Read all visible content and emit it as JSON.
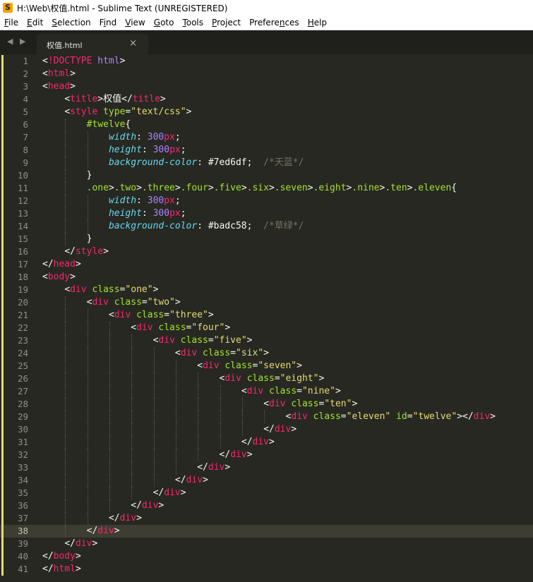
{
  "window": {
    "title": "H:\\Web\\权值.html - Sublime Text (UNREGISTERED)"
  },
  "menu": [
    {
      "label": "File",
      "key": "F"
    },
    {
      "label": "Edit",
      "key": "E"
    },
    {
      "label": "Selection",
      "key": "S"
    },
    {
      "label": "Find",
      "key": "i"
    },
    {
      "label": "View",
      "key": "V"
    },
    {
      "label": "Goto",
      "key": "G"
    },
    {
      "label": "Tools",
      "key": "T"
    },
    {
      "label": "Project",
      "key": "P"
    },
    {
      "label": "Preferences",
      "key": "n"
    },
    {
      "label": "Help",
      "key": "H"
    }
  ],
  "tabs": {
    "arrows": "◀ ▶",
    "active_label": "权值.html",
    "close_glyph": "×"
  },
  "editor": {
    "current_line": 38,
    "marker_color": "#e6db74",
    "lines": [
      {
        "n": "1",
        "i": 0,
        "t": [
          [
            "t-punct",
            "<"
          ],
          [
            "t-tag",
            "!DOCTYPE"
          ],
          [
            "t-text",
            " "
          ],
          [
            "t-num",
            "html"
          ],
          [
            "t-punct",
            ">"
          ]
        ]
      },
      {
        "n": "2",
        "i": 0,
        "t": [
          [
            "t-punct",
            "<"
          ],
          [
            "t-tag",
            "html"
          ],
          [
            "t-punct",
            ">"
          ]
        ]
      },
      {
        "n": "3",
        "i": 0,
        "t": [
          [
            "t-punct",
            "<"
          ],
          [
            "t-tag",
            "head"
          ],
          [
            "t-punct",
            ">"
          ]
        ]
      },
      {
        "n": "4",
        "i": 1,
        "t": [
          [
            "t-punct",
            "<"
          ],
          [
            "t-tag",
            "title"
          ],
          [
            "t-punct",
            ">"
          ],
          [
            "t-text",
            "权值"
          ],
          [
            "t-punct",
            "</"
          ],
          [
            "t-tag",
            "title"
          ],
          [
            "t-punct",
            ">"
          ]
        ]
      },
      {
        "n": "5",
        "i": 1,
        "t": [
          [
            "t-punct",
            "<"
          ],
          [
            "t-tag",
            "style"
          ],
          [
            "t-text",
            " "
          ],
          [
            "t-attr",
            "type"
          ],
          [
            "t-punct",
            "="
          ],
          [
            "t-str",
            "\"text/css\""
          ],
          [
            "t-punct",
            ">"
          ]
        ]
      },
      {
        "n": "6",
        "i": 2,
        "t": [
          [
            "t-sel",
            "#twelve"
          ],
          [
            "t-punct",
            "{"
          ]
        ]
      },
      {
        "n": "7",
        "i": 3,
        "t": [
          [
            "t-prop",
            "width"
          ],
          [
            "t-punct",
            ": "
          ],
          [
            "t-num",
            "300"
          ],
          [
            "t-tag",
            "px"
          ],
          [
            "t-punct",
            ";"
          ]
        ]
      },
      {
        "n": "8",
        "i": 3,
        "t": [
          [
            "t-prop",
            "height"
          ],
          [
            "t-punct",
            ": "
          ],
          [
            "t-num",
            "300"
          ],
          [
            "t-tag",
            "px"
          ],
          [
            "t-punct",
            ";"
          ]
        ]
      },
      {
        "n": "9",
        "i": 3,
        "t": [
          [
            "t-prop",
            "background-color"
          ],
          [
            "t-punct",
            ": "
          ],
          [
            "t-text",
            "#7ed6df"
          ],
          [
            "t-punct",
            ";  "
          ],
          [
            "t-com",
            "/*天蓝*/"
          ]
        ]
      },
      {
        "n": "10",
        "i": 2,
        "t": [
          [
            "t-punct",
            "}"
          ]
        ]
      },
      {
        "n": "11",
        "i": 2,
        "t": [
          [
            "t-sel",
            ".one"
          ],
          [
            "t-punct",
            ">"
          ],
          [
            "t-sel",
            ".two"
          ],
          [
            "t-punct",
            ">"
          ],
          [
            "t-sel",
            ".three"
          ],
          [
            "t-punct",
            ">"
          ],
          [
            "t-sel",
            ".four"
          ],
          [
            "t-punct",
            ">"
          ],
          [
            "t-sel",
            ".five"
          ],
          [
            "t-punct",
            ">"
          ],
          [
            "t-sel",
            ".six"
          ],
          [
            "t-punct",
            ">"
          ],
          [
            "t-sel",
            ".seven"
          ],
          [
            "t-punct",
            ">"
          ],
          [
            "t-sel",
            ".eight"
          ],
          [
            "t-punct",
            ">"
          ],
          [
            "t-sel",
            ".nine"
          ],
          [
            "t-punct",
            ">"
          ],
          [
            "t-sel",
            ".ten"
          ],
          [
            "t-punct",
            ">"
          ],
          [
            "t-sel",
            ".eleven"
          ],
          [
            "t-punct",
            "{"
          ]
        ]
      },
      {
        "n": "12",
        "i": 3,
        "t": [
          [
            "t-prop",
            "width"
          ],
          [
            "t-punct",
            ": "
          ],
          [
            "t-num",
            "300"
          ],
          [
            "t-tag",
            "px"
          ],
          [
            "t-punct",
            ";"
          ]
        ]
      },
      {
        "n": "13",
        "i": 3,
        "t": [
          [
            "t-prop",
            "height"
          ],
          [
            "t-punct",
            ": "
          ],
          [
            "t-num",
            "300"
          ],
          [
            "t-tag",
            "px"
          ],
          [
            "t-punct",
            ";"
          ]
        ]
      },
      {
        "n": "14",
        "i": 3,
        "t": [
          [
            "t-prop",
            "background-color"
          ],
          [
            "t-punct",
            ": "
          ],
          [
            "t-text",
            "#badc58"
          ],
          [
            "t-punct",
            ";  "
          ],
          [
            "t-com",
            "/*草绿*/"
          ]
        ]
      },
      {
        "n": "15",
        "i": 2,
        "t": [
          [
            "t-punct",
            "}"
          ]
        ]
      },
      {
        "n": "16",
        "i": 1,
        "t": [
          [
            "t-punct",
            "</"
          ],
          [
            "t-tag",
            "style"
          ],
          [
            "t-punct",
            ">"
          ]
        ]
      },
      {
        "n": "17",
        "i": 0,
        "t": [
          [
            "t-punct",
            "</"
          ],
          [
            "t-tag",
            "head"
          ],
          [
            "t-punct",
            ">"
          ]
        ]
      },
      {
        "n": "18",
        "i": 0,
        "t": [
          [
            "t-punct",
            "<"
          ],
          [
            "t-tag",
            "body"
          ],
          [
            "t-punct",
            ">"
          ]
        ]
      },
      {
        "n": "19",
        "i": 1,
        "t": [
          [
            "t-punct",
            "<"
          ],
          [
            "t-tag",
            "div"
          ],
          [
            "t-text",
            " "
          ],
          [
            "t-attr",
            "class"
          ],
          [
            "t-punct",
            "="
          ],
          [
            "t-str",
            "\"one\""
          ],
          [
            "t-punct",
            ">"
          ]
        ]
      },
      {
        "n": "20",
        "i": 2,
        "t": [
          [
            "t-punct",
            "<"
          ],
          [
            "t-tag",
            "div"
          ],
          [
            "t-text",
            " "
          ],
          [
            "t-attr",
            "class"
          ],
          [
            "t-punct",
            "="
          ],
          [
            "t-str",
            "\"two\""
          ],
          [
            "t-punct",
            ">"
          ]
        ]
      },
      {
        "n": "21",
        "i": 3,
        "t": [
          [
            "t-punct",
            "<"
          ],
          [
            "t-tag",
            "div"
          ],
          [
            "t-text",
            " "
          ],
          [
            "t-attr",
            "class"
          ],
          [
            "t-punct",
            "="
          ],
          [
            "t-str",
            "\"three\""
          ],
          [
            "t-punct",
            ">"
          ]
        ]
      },
      {
        "n": "22",
        "i": 4,
        "t": [
          [
            "t-punct",
            "<"
          ],
          [
            "t-tag",
            "div"
          ],
          [
            "t-text",
            " "
          ],
          [
            "t-attr",
            "class"
          ],
          [
            "t-punct",
            "="
          ],
          [
            "t-str",
            "\"four\""
          ],
          [
            "t-punct",
            ">"
          ]
        ]
      },
      {
        "n": "23",
        "i": 5,
        "t": [
          [
            "t-punct",
            "<"
          ],
          [
            "t-tag",
            "div"
          ],
          [
            "t-text",
            " "
          ],
          [
            "t-attr",
            "class"
          ],
          [
            "t-punct",
            "="
          ],
          [
            "t-str",
            "\"five\""
          ],
          [
            "t-punct",
            ">"
          ]
        ]
      },
      {
        "n": "24",
        "i": 6,
        "t": [
          [
            "t-punct",
            "<"
          ],
          [
            "t-tag",
            "div"
          ],
          [
            "t-text",
            " "
          ],
          [
            "t-attr",
            "class"
          ],
          [
            "t-punct",
            "="
          ],
          [
            "t-str",
            "\"six\""
          ],
          [
            "t-punct",
            ">"
          ]
        ]
      },
      {
        "n": "25",
        "i": 7,
        "t": [
          [
            "t-punct",
            "<"
          ],
          [
            "t-tag",
            "div"
          ],
          [
            "t-text",
            " "
          ],
          [
            "t-attr",
            "class"
          ],
          [
            "t-punct",
            "="
          ],
          [
            "t-str",
            "\"seven\""
          ],
          [
            "t-punct",
            ">"
          ]
        ]
      },
      {
        "n": "26",
        "i": 8,
        "t": [
          [
            "t-punct",
            "<"
          ],
          [
            "t-tag",
            "div"
          ],
          [
            "t-text",
            " "
          ],
          [
            "t-attr",
            "class"
          ],
          [
            "t-punct",
            "="
          ],
          [
            "t-str",
            "\"eight\""
          ],
          [
            "t-punct",
            ">"
          ]
        ]
      },
      {
        "n": "27",
        "i": 9,
        "t": [
          [
            "t-punct",
            "<"
          ],
          [
            "t-tag",
            "div"
          ],
          [
            "t-text",
            " "
          ],
          [
            "t-attr",
            "class"
          ],
          [
            "t-punct",
            "="
          ],
          [
            "t-str",
            "\"nine\""
          ],
          [
            "t-punct",
            ">"
          ]
        ]
      },
      {
        "n": "28",
        "i": 10,
        "t": [
          [
            "t-punct",
            "<"
          ],
          [
            "t-tag",
            "div"
          ],
          [
            "t-text",
            " "
          ],
          [
            "t-attr",
            "class"
          ],
          [
            "t-punct",
            "="
          ],
          [
            "t-str",
            "\"ten\""
          ],
          [
            "t-punct",
            ">"
          ]
        ]
      },
      {
        "n": "29",
        "i": 11,
        "t": [
          [
            "t-punct",
            "<"
          ],
          [
            "t-tag",
            "div"
          ],
          [
            "t-text",
            " "
          ],
          [
            "t-attr",
            "class"
          ],
          [
            "t-punct",
            "="
          ],
          [
            "t-str",
            "\"eleven\""
          ],
          [
            "t-text",
            " "
          ],
          [
            "t-attr",
            "id"
          ],
          [
            "t-punct",
            "="
          ],
          [
            "t-str",
            "\"twelve\""
          ],
          [
            "t-punct",
            "></"
          ],
          [
            "t-tag",
            "div"
          ],
          [
            "t-punct",
            ">"
          ]
        ]
      },
      {
        "n": "30",
        "i": 10,
        "t": [
          [
            "t-punct",
            "</"
          ],
          [
            "t-tag",
            "div"
          ],
          [
            "t-punct",
            ">"
          ]
        ]
      },
      {
        "n": "31",
        "i": 9,
        "t": [
          [
            "t-punct",
            "</"
          ],
          [
            "t-tag",
            "div"
          ],
          [
            "t-punct",
            ">"
          ]
        ]
      },
      {
        "n": "32",
        "i": 8,
        "t": [
          [
            "t-punct",
            "</"
          ],
          [
            "t-tag",
            "div"
          ],
          [
            "t-punct",
            ">"
          ]
        ]
      },
      {
        "n": "33",
        "i": 7,
        "t": [
          [
            "t-punct",
            "</"
          ],
          [
            "t-tag",
            "div"
          ],
          [
            "t-punct",
            ">"
          ]
        ]
      },
      {
        "n": "34",
        "i": 6,
        "t": [
          [
            "t-punct",
            "</"
          ],
          [
            "t-tag",
            "div"
          ],
          [
            "t-punct",
            ">"
          ]
        ]
      },
      {
        "n": "35",
        "i": 5,
        "t": [
          [
            "t-punct",
            "</"
          ],
          [
            "t-tag",
            "div"
          ],
          [
            "t-punct",
            ">"
          ]
        ]
      },
      {
        "n": "36",
        "i": 4,
        "t": [
          [
            "t-punct",
            "</"
          ],
          [
            "t-tag",
            "div"
          ],
          [
            "t-punct",
            ">"
          ]
        ]
      },
      {
        "n": "37",
        "i": 3,
        "t": [
          [
            "t-punct",
            "</"
          ],
          [
            "t-tag",
            "div"
          ],
          [
            "t-punct",
            ">"
          ]
        ]
      },
      {
        "n": "38",
        "i": 2,
        "t": [
          [
            "t-punct",
            "</"
          ],
          [
            "t-tag",
            "div"
          ],
          [
            "t-punct",
            ">"
          ]
        ]
      },
      {
        "n": "39",
        "i": 1,
        "t": [
          [
            "t-punct",
            "</"
          ],
          [
            "t-tag",
            "div"
          ],
          [
            "t-punct",
            ">"
          ]
        ]
      },
      {
        "n": "40",
        "i": 0,
        "t": [
          [
            "t-punct",
            "</"
          ],
          [
            "t-tag",
            "body"
          ],
          [
            "t-punct",
            ">"
          ]
        ]
      },
      {
        "n": "41",
        "i": 0,
        "t": [
          [
            "t-punct",
            "</"
          ],
          [
            "t-tag",
            "html"
          ],
          [
            "t-punct",
            ">"
          ]
        ]
      }
    ]
  }
}
